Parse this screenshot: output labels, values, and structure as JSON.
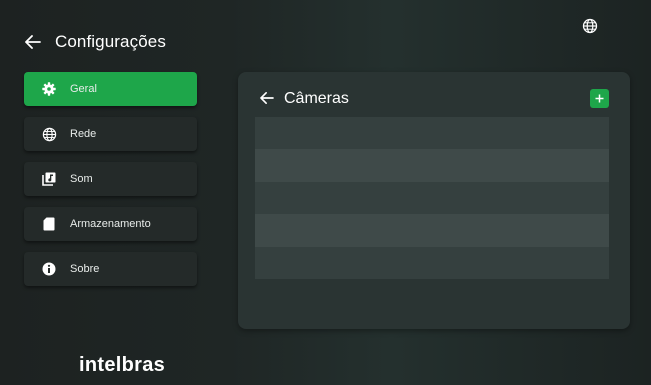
{
  "header": {
    "title": "Configurações",
    "back_icon": "arrow-left-icon",
    "language_icon": "globe-icon"
  },
  "sidebar": {
    "items": [
      {
        "label": "Geral",
        "icon": "gear-icon",
        "active": true
      },
      {
        "label": "Rede",
        "icon": "globe-icon",
        "active": false
      },
      {
        "label": "Som",
        "icon": "music-library-icon",
        "active": false
      },
      {
        "label": "Armazenamento",
        "icon": "sd-card-icon",
        "active": false
      },
      {
        "label": "Sobre",
        "icon": "info-icon",
        "active": false
      }
    ]
  },
  "brand": {
    "logo_text": "intelbras"
  },
  "main": {
    "title": "Câmeras",
    "back_icon": "arrow-left-icon",
    "add_icon": "plus-icon",
    "rows": [
      "",
      "",
      "",
      "",
      ""
    ]
  },
  "colors": {
    "accent": "#1ea64a",
    "background": "#1f2625",
    "panel": "#2a3433",
    "row_dark": "#35403f",
    "row_light": "#3f4a49"
  }
}
